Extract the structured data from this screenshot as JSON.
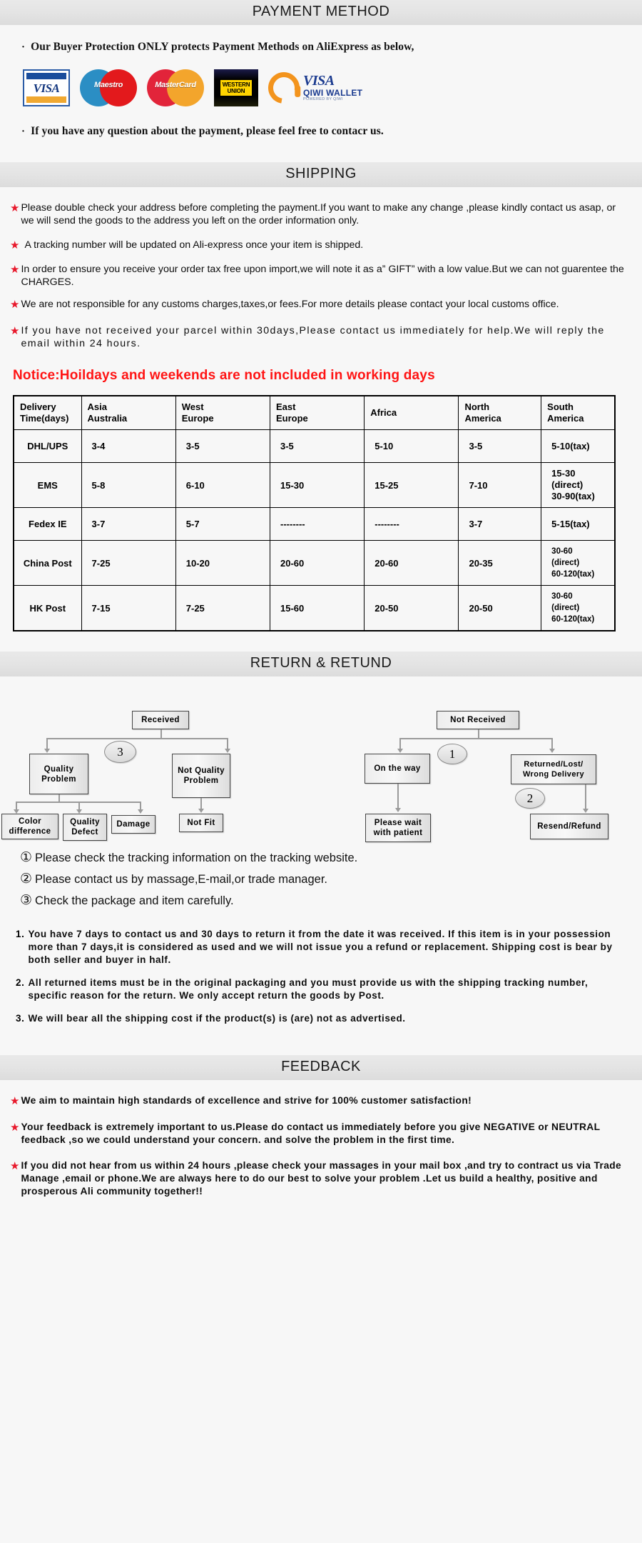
{
  "sections": {
    "payment": {
      "title": "PAYMENT METHOD",
      "bullet1": "Our Buyer Protection ONLY protects Payment Methods on AliExpress as below,",
      "bullet2": "If you have any question about the payment, please feel free to contacr us.",
      "bullet_dot": "·",
      "logos": [
        {
          "name": "visa-logo",
          "label": "VISA"
        },
        {
          "name": "maestro-logo",
          "label": "Maestro"
        },
        {
          "name": "mastercard-logo",
          "label": "MasterCard"
        },
        {
          "name": "western-union-logo",
          "line1": "WESTERN",
          "line2": "UNION"
        },
        {
          "name": "qiwi-wallet-logo",
          "visa": "VISA",
          "wallet": "QIWI WALLET",
          "powered": "POWERED BY QIWI"
        }
      ]
    },
    "shipping": {
      "title": "SHIPPING",
      "items": [
        "Please double check your address before completing the payment.If you want to make any change ,please kindly contact us asap, or we will send the goods to the address you left on the order information only.",
        "A tracking number will be updated on Ali-express once your item is shipped.",
        "In order to ensure you receive your order tax free upon import,we will note it as a” GIFT” with a low value.But we can not guarentee the CHARGES.",
        "We are not responsible for any customs charges,taxes,or fees.For more details please contact your local customs office.",
        "If you have not received your parcel within 30days,Please contact us immediately for help.We will reply the email within 24 hours."
      ],
      "notice": "Notice:Hoildays and weekends are not included in working days",
      "star_glyph": "★"
    },
    "return": {
      "title": "RETURN & RETUND",
      "flow": {
        "received": "Received",
        "quality_problem": "Quality\nProblem",
        "not_quality_problem": "Not Quality\nProblem",
        "color_difference": "Color\ndifference",
        "quality_defect": "Quality\nDefect",
        "damage": "Damage",
        "not_fit": "Not Fit",
        "not_received": "Not  Received",
        "on_the_way": "On the way",
        "returned_lost": "Returned/Lost/\nWrong Delivery",
        "please_wait": "Please wait\nwith patient",
        "resend_refund": "Resend/Refund",
        "badge1": "1",
        "badge2": "2",
        "badge3": "3"
      },
      "circled_notes": [
        {
          "num": "①",
          "text": "Please check the tracking information on the tracking website."
        },
        {
          "num": "②",
          "text": "Please contact us by  massage,E-mail,or trade manager."
        },
        {
          "num": "③",
          "text": "Check the package and item carefully."
        }
      ],
      "numbered": [
        {
          "n": "1.",
          "text": "You have 7 days to contact us and 30 days to return it from the date it was received. If this item is in your possession more than 7 days,it is considered as used and we will not issue you a refund or replacement. Shipping cost is bear by both seller and buyer in half."
        },
        {
          "n": "2.",
          "text": "All returned items must be in the original packaging and you must provide us with the shipping tracking number, specific reason for the return. We only accept return the goods by Post."
        },
        {
          "n": "3.",
          "text": "We will bear all the shipping cost if the product(s) is (are) not as advertised."
        }
      ]
    },
    "feedback": {
      "title": "FEEDBACK",
      "items": [
        "We aim to maintain high standards of excellence and strive  for 100% customer satisfaction!",
        "Your feedback is extremely important to us.Please do contact us immediately before you give NEGATIVE or NEUTRAL feedback ,so  we could understand your concern. and solve the problem in the first time.",
        "If you did not hear from us within 24 hours ,please check your massages in your mail box ,and try to contract us via Trade Manage ,email or phone.We are always here to do our best to solve your problem .Let us build a healthy, positive and prosperous Ali community together!!"
      ]
    }
  },
  "table": {
    "headers": [
      "Delivery\nTime(days)",
      "Asia\nAustralia",
      "West\nEurope",
      "East\nEurope",
      "Africa",
      "North\nAmerica",
      "South\nAmerica"
    ],
    "rows": [
      {
        "method": "DHL/UPS",
        "cells": [
          "3-4",
          "3-5",
          "3-5",
          "5-10",
          "3-5",
          "5-10(tax)"
        ]
      },
      {
        "method": "EMS",
        "cells": [
          "5-8",
          "6-10",
          "15-30",
          "15-25",
          "7-10",
          "15-30\n(direct)\n30-90(tax)"
        ]
      },
      {
        "method": "Fedex IE",
        "cells": [
          "3-7",
          "5-7",
          "--------",
          "--------",
          "3-7",
          "5-15(tax)"
        ]
      },
      {
        "method": "China Post",
        "cells": [
          "7-25",
          "10-20",
          "20-60",
          "20-60",
          "20-35",
          "30-60\n(direct)\n60-120(tax)"
        ]
      },
      {
        "method": "HK Post",
        "cells": [
          "7-15",
          "7-25",
          "15-60",
          "20-50",
          "20-50",
          "30-60\n(direct)\n60-120(tax)"
        ]
      }
    ]
  },
  "colors": {
    "star_red": "#e8192c",
    "notice_red": "#ff1414",
    "band_grey": "#e4e4e4",
    "page_bg": "#f7f7f7"
  }
}
